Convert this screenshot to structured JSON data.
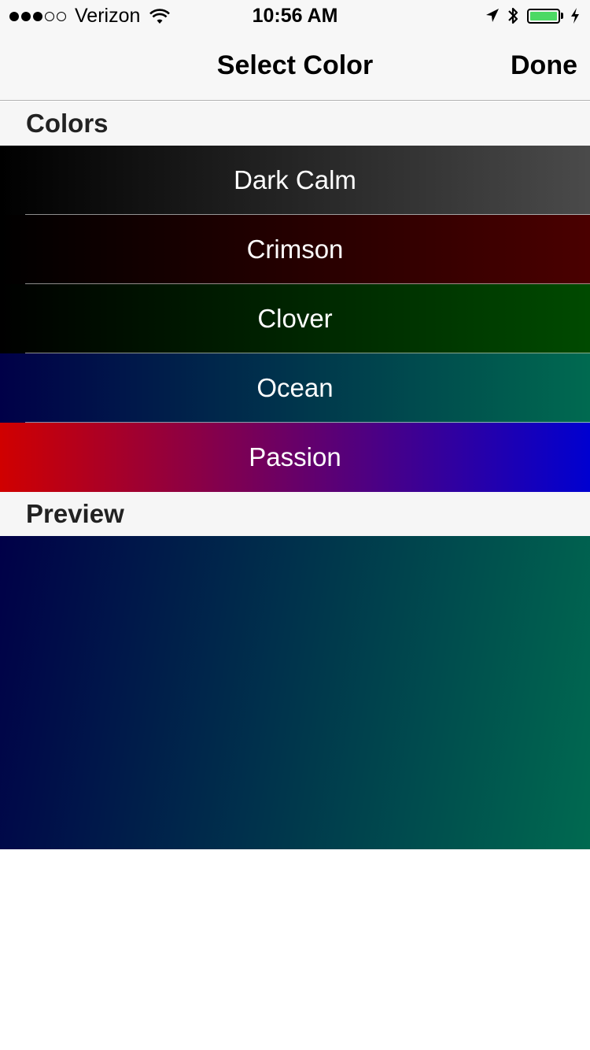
{
  "status_bar": {
    "signal_dots": [
      true,
      true,
      true,
      false,
      false
    ],
    "carrier": "Verizon",
    "time": "10:56 AM",
    "icons": [
      "wifi-icon",
      "location-arrow-icon",
      "bluetooth-icon",
      "battery-icon",
      "charging-bolt-icon"
    ],
    "battery_color": "#4cd964"
  },
  "nav": {
    "title": "Select Color",
    "done_label": "Done"
  },
  "sections": {
    "colors_label": "Colors",
    "preview_label": "Preview"
  },
  "colors": [
    {
      "label": "Dark Calm",
      "from": "#000000",
      "to": "#4a4a4a"
    },
    {
      "label": "Crimson",
      "from": "#000000",
      "to": "#4a0000"
    },
    {
      "label": "Clover",
      "from": "#000000",
      "to": "#004a00"
    },
    {
      "label": "Ocean",
      "from": "#000048",
      "to": "#006a50"
    },
    {
      "label": "Passion",
      "from": "#d00000",
      "to": "#0000d0"
    }
  ],
  "preview": {
    "from": "#000048",
    "to": "#006a50"
  }
}
